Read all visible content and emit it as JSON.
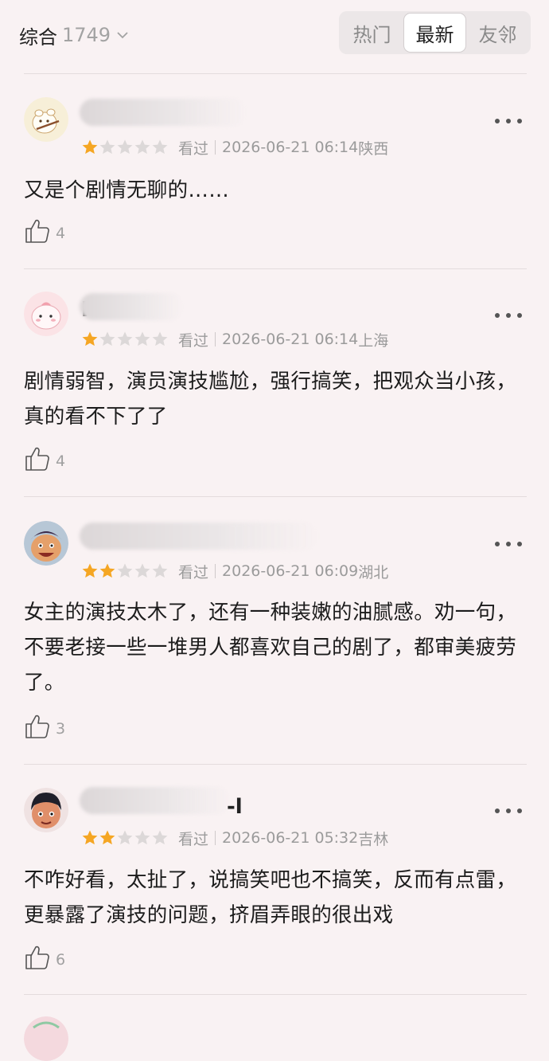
{
  "header": {
    "sort_label": "综合",
    "count": "1749",
    "tabs": [
      {
        "label": "热门",
        "active": false
      },
      {
        "label": "最新",
        "active": true
      },
      {
        "label": "友邻",
        "active": false
      }
    ]
  },
  "reviews": [
    {
      "name_visible": "",
      "rating": 1,
      "status": "看过",
      "datetime": "2026-06-21 06:14",
      "location": "陕西",
      "text": "又是个剧情无聊的……",
      "likes": "4"
    },
    {
      "name_visible": "",
      "rating": 1,
      "status": "看过",
      "datetime": "2026-06-21 06:14",
      "location": "上海",
      "text": "剧情弱智，演员演技尴尬，强行搞笑，把观众当小孩，真的看不下了了",
      "likes": "4"
    },
    {
      "name_visible": "",
      "rating": 2,
      "status": "看过",
      "datetime": "2026-06-21 06:09",
      "location": "湖北",
      "text": "女主的演技太木了，还有一种装嫩的油腻感。劝一句，不要老接一些一堆男人都喜欢自己的剧了，都审美疲劳了。",
      "likes": "3"
    },
    {
      "name_visible": "-l",
      "rating": 2,
      "status": "看过",
      "datetime": "2026-06-21 05:32",
      "location": "吉林",
      "text": "不咋好看，太扯了，说搞笑吧也不搞笑，反而有点雷，更暴露了演技的问题，挤眉弄眼的很出戏",
      "likes": "6"
    }
  ],
  "colors": {
    "background": "#f9f2f3",
    "star_filled": "#f5a623",
    "star_empty": "#dcd8d8"
  }
}
